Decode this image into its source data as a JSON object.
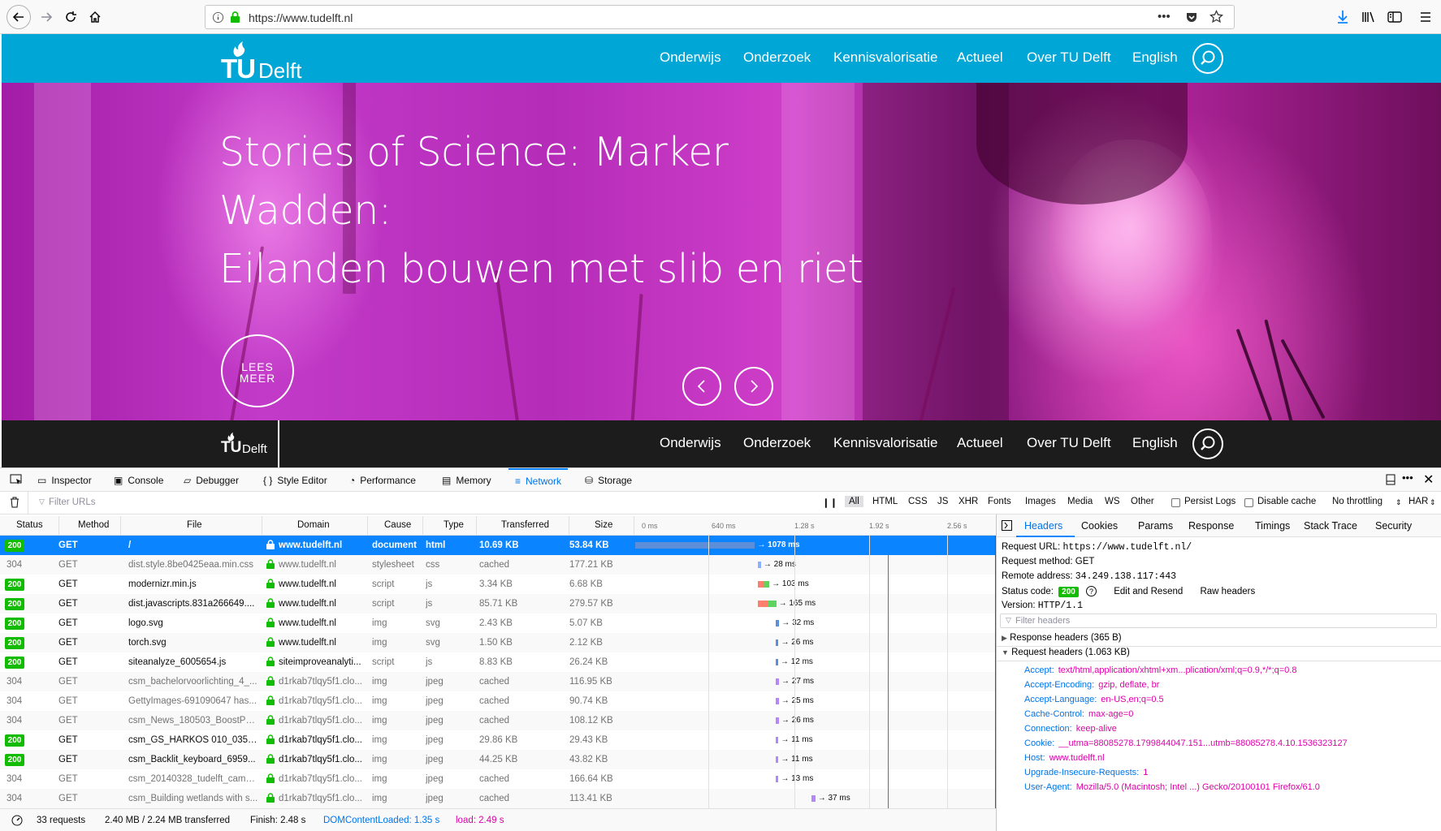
{
  "browser": {
    "url": "https://www.tudelft.nl",
    "icons": [
      "back-icon",
      "forward-icon",
      "reload-icon",
      "home-icon",
      "info-icon",
      "lock-icon",
      "more-icon",
      "pocket-icon",
      "star-icon",
      "download-icon",
      "library-icon",
      "sidebar-icon",
      "menu-icon"
    ]
  },
  "site": {
    "logo_tu": "TU",
    "logo_delft": "Delft",
    "nav": [
      "Onderwijs",
      "Onderzoek",
      "Kennisvalorisatie",
      "Actueel",
      "Over TU Delft",
      "English"
    ],
    "headline_1": "Stories of Science: Marker Wadden:",
    "headline_2": "Eilanden bouwen met slib en riet",
    "cta_1": "LEES",
    "cta_2": "MEER",
    "colors": {
      "nav": "#00a6d6",
      "sticky": "#1c1c1c"
    }
  },
  "devtools": {
    "tabs": [
      "Inspector",
      "Console",
      "Debugger",
      "Style Editor",
      "Performance",
      "Memory",
      "Network",
      "Storage"
    ],
    "selected_tab": "Network",
    "filter_placeholder": "Filter URLs",
    "types": [
      "All",
      "HTML",
      "CSS",
      "JS",
      "XHR",
      "Fonts",
      "Images",
      "Media",
      "WS",
      "Other"
    ],
    "persist_logs": "Persist Logs",
    "disable_cache": "Disable cache",
    "throttling": "No throttling",
    "har": "HAR",
    "columns": [
      "Status",
      "Method",
      "File",
      "Domain",
      "Cause",
      "Type",
      "Transferred",
      "Size"
    ],
    "waterfall_ticks": [
      "0 ms",
      "640 ms",
      "1.28 s",
      "1.92 s",
      "2.56 s"
    ],
    "requests": [
      {
        "status": "200",
        "method": "GET",
        "file": "/",
        "domain": "www.tudelft.nl",
        "cause": "document",
        "type": "html",
        "transferred": "10.69 KB",
        "size": "53.84 KB",
        "time": "→ 1078 ms",
        "wf_start": 0,
        "wf_len": 1078
      },
      {
        "status": "304",
        "method": "GET",
        "file": "dist.style.8be0425eaa.min.css",
        "domain": "www.tudelft.nl",
        "cause": "stylesheet",
        "type": "css",
        "transferred": "cached",
        "size": "177.21 KB",
        "time": "→ 28 ms",
        "wf_start": 1105,
        "wf_len": 28
      },
      {
        "status": "200",
        "method": "GET",
        "file": "modernizr.min.js",
        "domain": "www.tudelft.nl",
        "cause": "script",
        "type": "js",
        "transferred": "3.34 KB",
        "size": "6.68 KB",
        "time": "→ 103 ms",
        "wf_start": 1105,
        "wf_len": 103
      },
      {
        "status": "200",
        "method": "GET",
        "file": "dist.javascripts.831a266649....",
        "domain": "www.tudelft.nl",
        "cause": "script",
        "type": "js",
        "transferred": "85.71 KB",
        "size": "279.57 KB",
        "time": "→ 165 ms",
        "wf_start": 1105,
        "wf_len": 165
      },
      {
        "status": "200",
        "method": "GET",
        "file": "logo.svg",
        "domain": "www.tudelft.nl",
        "cause": "img",
        "type": "svg",
        "transferred": "2.43 KB",
        "size": "5.07 KB",
        "time": "→ 32 ms",
        "wf_start": 1265,
        "wf_len": 32
      },
      {
        "status": "200",
        "method": "GET",
        "file": "torch.svg",
        "domain": "www.tudelft.nl",
        "cause": "img",
        "type": "svg",
        "transferred": "1.50 KB",
        "size": "2.12 KB",
        "time": "→ 26 ms",
        "wf_start": 1265,
        "wf_len": 26
      },
      {
        "status": "200",
        "method": "GET",
        "file": "siteanalyze_6005654.js",
        "domain": "siteimproveanalyti...",
        "cause": "script",
        "type": "js",
        "transferred": "8.83 KB",
        "size": "26.24 KB",
        "time": "→ 12 ms",
        "wf_start": 1265,
        "wf_len": 12
      },
      {
        "status": "304",
        "method": "GET",
        "file": "csm_bachelorvoorlichting_4_...",
        "domain": "d1rkab7tlqy5f1.clo...",
        "cause": "img",
        "type": "jpeg",
        "transferred": "cached",
        "size": "116.95 KB",
        "time": "→ 27 ms",
        "wf_start": 1268,
        "wf_len": 27
      },
      {
        "status": "304",
        "method": "GET",
        "file": "GettyImages-691090647 has...",
        "domain": "d1rkab7tlqy5f1.clo...",
        "cause": "img",
        "type": "jpeg",
        "transferred": "cached",
        "size": "90.74 KB",
        "time": "→ 25 ms",
        "wf_start": 1268,
        "wf_len": 25
      },
      {
        "status": "304",
        "method": "GET",
        "file": "csm_News_180503_BoostPhy...",
        "domain": "d1rkab7tlqy5f1.clo...",
        "cause": "img",
        "type": "jpeg",
        "transferred": "cached",
        "size": "108.12 KB",
        "time": "→ 26 ms",
        "wf_start": 1268,
        "wf_len": 26
      },
      {
        "status": "200",
        "method": "GET",
        "file": "csm_GS_HARKOS 010_03558...",
        "domain": "d1rkab7tlqy5f1.clo...",
        "cause": "img",
        "type": "jpeg",
        "transferred": "29.86 KB",
        "size": "29.43 KB",
        "time": "→ 11 ms",
        "wf_start": 1268,
        "wf_len": 11
      },
      {
        "status": "200",
        "method": "GET",
        "file": "csm_Backlit_keyboard_6959...",
        "domain": "d1rkab7tlqy5f1.clo...",
        "cause": "img",
        "type": "jpeg",
        "transferred": "44.25 KB",
        "size": "43.82 KB",
        "time": "→ 11 ms",
        "wf_start": 1268,
        "wf_len": 11
      },
      {
        "status": "304",
        "method": "GET",
        "file": "csm_20140328_tudelft_camp...",
        "domain": "d1rkab7tlqy5f1.clo...",
        "cause": "img",
        "type": "jpeg",
        "transferred": "cached",
        "size": "166.64 KB",
        "time": "→ 13 ms",
        "wf_start": 1268,
        "wf_len": 13
      },
      {
        "status": "304",
        "method": "GET",
        "file": "csm_Building wetlands with s...",
        "domain": "d1rkab7tlqy5f1.clo...",
        "cause": "img",
        "type": "jpeg",
        "transferred": "cached",
        "size": "113.41 KB",
        "time": "→ 37 ms",
        "wf_start": 1585,
        "wf_len": 37
      }
    ],
    "summary": {
      "requests": "33 requests",
      "transferred": "2.40 MB / 2.24 MB transferred",
      "finish": "Finish: 2.48 s",
      "dcl": "DOMContentLoaded: 1.35 s",
      "load": "load: 2.49 s"
    },
    "side_tabs": [
      "Headers",
      "Cookies",
      "Params",
      "Response",
      "Timings",
      "Stack Trace",
      "Security"
    ],
    "side_selected": "Headers",
    "req_url_label": "Request URL:",
    "req_url": "https://www.tudelft.nl/",
    "req_method_label": "Request method:",
    "req_method": "GET",
    "remote_label": "Remote address:",
    "remote": "34.249.138.117:443",
    "status_label": "Status code:",
    "status_code": "200",
    "edit_resend": "Edit and Resend",
    "raw_headers": "Raw headers",
    "version_label": "Version:",
    "version": "HTTP/1.1",
    "filter_headers": "Filter headers",
    "response_headers": "Response headers (365 B)",
    "request_headers": "Request headers (1.063 KB)",
    "headers": [
      {
        "k": "Accept:",
        "v": "text/html,application/xhtml+xm...plication/xml;q=0.9,*/*;q=0.8"
      },
      {
        "k": "Accept-Encoding:",
        "v": "gzip, deflate, br"
      },
      {
        "k": "Accept-Language:",
        "v": "en-US,en;q=0.5"
      },
      {
        "k": "Cache-Control:",
        "v": "max-age=0"
      },
      {
        "k": "Connection:",
        "v": "keep-alive"
      },
      {
        "k": "Cookie:",
        "v": "__utma=88085278.1799844047.151...utmb=88085278.4.10.1536323127"
      },
      {
        "k": "Host:",
        "v": "www.tudelft.nl"
      },
      {
        "k": "Upgrade-Insecure-Requests:",
        "v": "1"
      },
      {
        "k": "User-Agent:",
        "v": "Mozilla/5.0 (Macintosh; Intel ...) Gecko/20100101 Firefox/61.0"
      }
    ]
  }
}
